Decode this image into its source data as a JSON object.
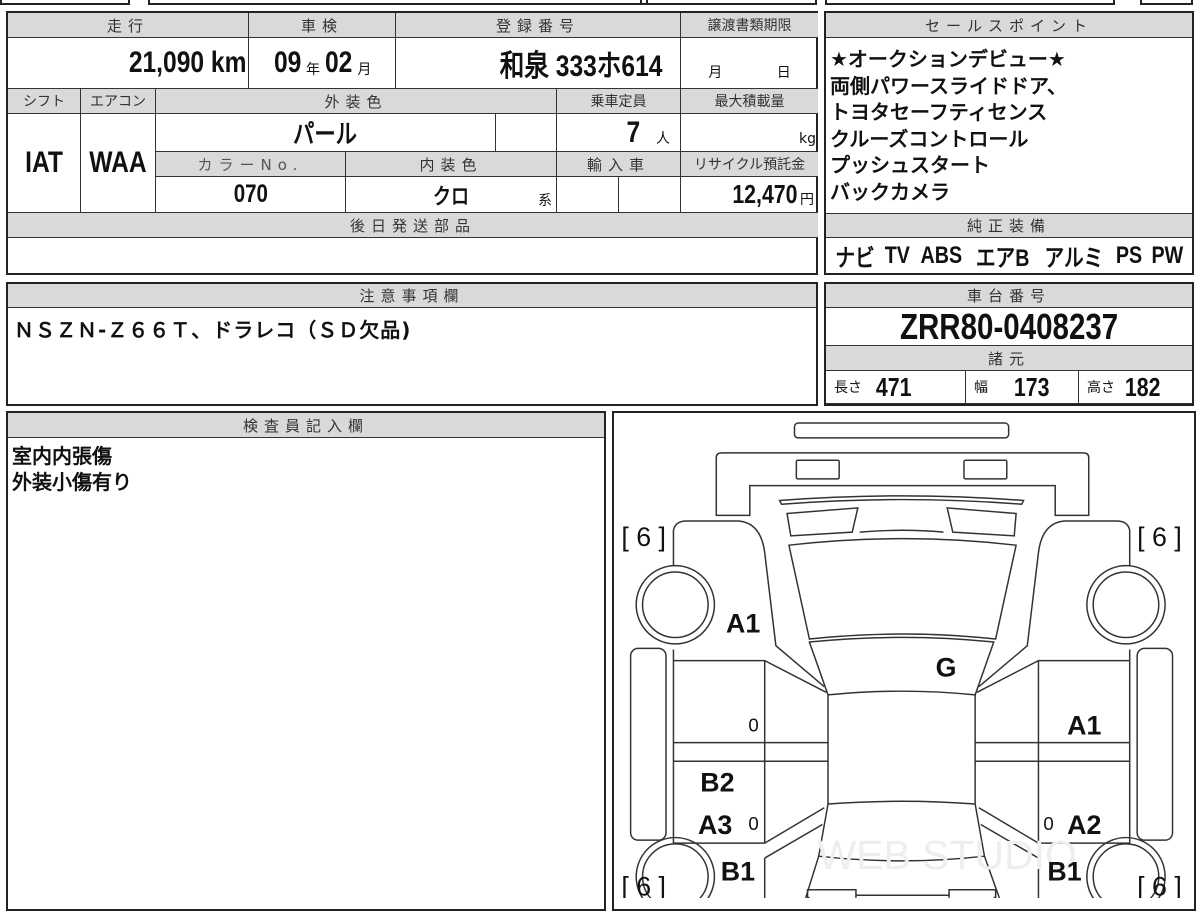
{
  "main_table": {
    "mileage_header": "走行",
    "mileage_value": "21,090",
    "mileage_unit": "km",
    "inspection_header": "車検",
    "inspection_year": "09",
    "year_unit": "年",
    "inspection_month": "02",
    "month_unit": "月",
    "registration_header": "登録番号",
    "registration_value": "和泉 333ホ614",
    "transfer_deadline_header": "譲渡書類期限",
    "transfer_month_unit": "月",
    "transfer_day_unit": "日",
    "shift_header": "シフト",
    "shift_value": "IAT",
    "ac_header": "エアコン",
    "ac_value": "WAA",
    "exterior_color_header": "外装色",
    "exterior_color_value": "パール",
    "capacity_header": "乗車定員",
    "capacity_value": "7",
    "capacity_unit": "人",
    "max_load_header": "最大積載量",
    "max_load_unit": "kg",
    "color_no_header": "カラーNo.",
    "color_no_value": "070",
    "interior_color_header": "内装色",
    "interior_color_value": "クロ",
    "interior_suffix": "系",
    "import_header": "輸入車",
    "recycle_header": "リサイクル預託金",
    "recycle_value": "12,470",
    "recycle_unit": "円",
    "later_parts_header": "後日発送部品"
  },
  "sales_points": {
    "header": "セールスポイント",
    "lines": [
      "★オークションデビュー★",
      "両側パワースライドドア、",
      "トヨタセーフティセンス",
      "クルーズコントロール",
      "プッシュスタート",
      "バックカメラ"
    ]
  },
  "equipment": {
    "header": "純正装備",
    "items": [
      "ナビ",
      "TV",
      "ABS",
      "エアB",
      "アルミ",
      "PS",
      "PW"
    ]
  },
  "notes": {
    "header": "注意事項欄",
    "text": "ＮＳＺＮ-Ｚ６６Ｔ、ドラレコ（ＳＤ欠品)"
  },
  "chassis": {
    "header": "車台番号",
    "value": "ZRR80-0408237",
    "specs_header": "諸元",
    "length_label": "長さ",
    "length": "471",
    "width_label": "幅",
    "width": "173",
    "height_label": "高さ",
    "height": "182"
  },
  "inspector": {
    "header": "検査員記入欄",
    "lines": [
      "室内内張傷",
      "外装小傷有り"
    ]
  },
  "diagram": {
    "tires": [
      "[ 6 ]",
      "[ 6 ]",
      "[ 6 ]",
      "[ 6 ]"
    ],
    "marks": [
      "A1",
      "G",
      "0",
      "A1",
      "B2",
      "A3",
      "0",
      "0",
      "A2",
      "B1",
      "B1",
      "A2",
      "A3"
    ],
    "watermark": "WEB STUDIO"
  }
}
